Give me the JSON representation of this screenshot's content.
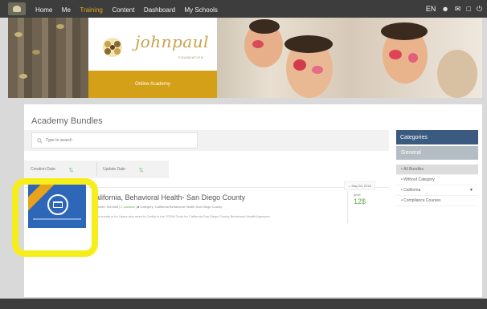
{
  "nav": {
    "items": [
      "Home",
      "Me",
      "Training",
      "Content",
      "Dashboard",
      "My Schools"
    ],
    "active_index": 2,
    "lang": "EN"
  },
  "banner": {
    "logo_text": "johnpaul",
    "logo_sub": "FOUNDATION",
    "academy_label": "Online Academy"
  },
  "page": {
    "title": "Academy Bundles",
    "search_placeholder": "Type to search"
  },
  "sort": {
    "creation": "Creation Date",
    "update": "Update Date"
  },
  "course": {
    "date": "May 08, 2018",
    "title": "alifornia, Behavioral Health- San Diego County",
    "author": "Lauren Schmidt",
    "courses": "2 courses",
    "category": "Category: California Behavioral Health-San Diego County",
    "description": "s bundle is for Users who need to Certify in the TGDM Tools for California San Diego County Behavioral Health Agencies.",
    "price_label": "price",
    "price": "12$"
  },
  "sidebar": {
    "header": "Categories",
    "general": "General",
    "items": [
      {
        "label": "All Bundles",
        "selected": true
      },
      {
        "label": "Without Category",
        "selected": false
      },
      {
        "label": "California",
        "selected": false,
        "has_caret": true
      },
      {
        "label": "Compliance Courses",
        "selected": false
      }
    ]
  },
  "colors": {
    "nav_bg": "#3d3d3d",
    "nav_active": "#e8a31a",
    "categories_header": "#3a5a80",
    "price_green": "#6aa84f",
    "highlight": "#f6ee1c"
  }
}
